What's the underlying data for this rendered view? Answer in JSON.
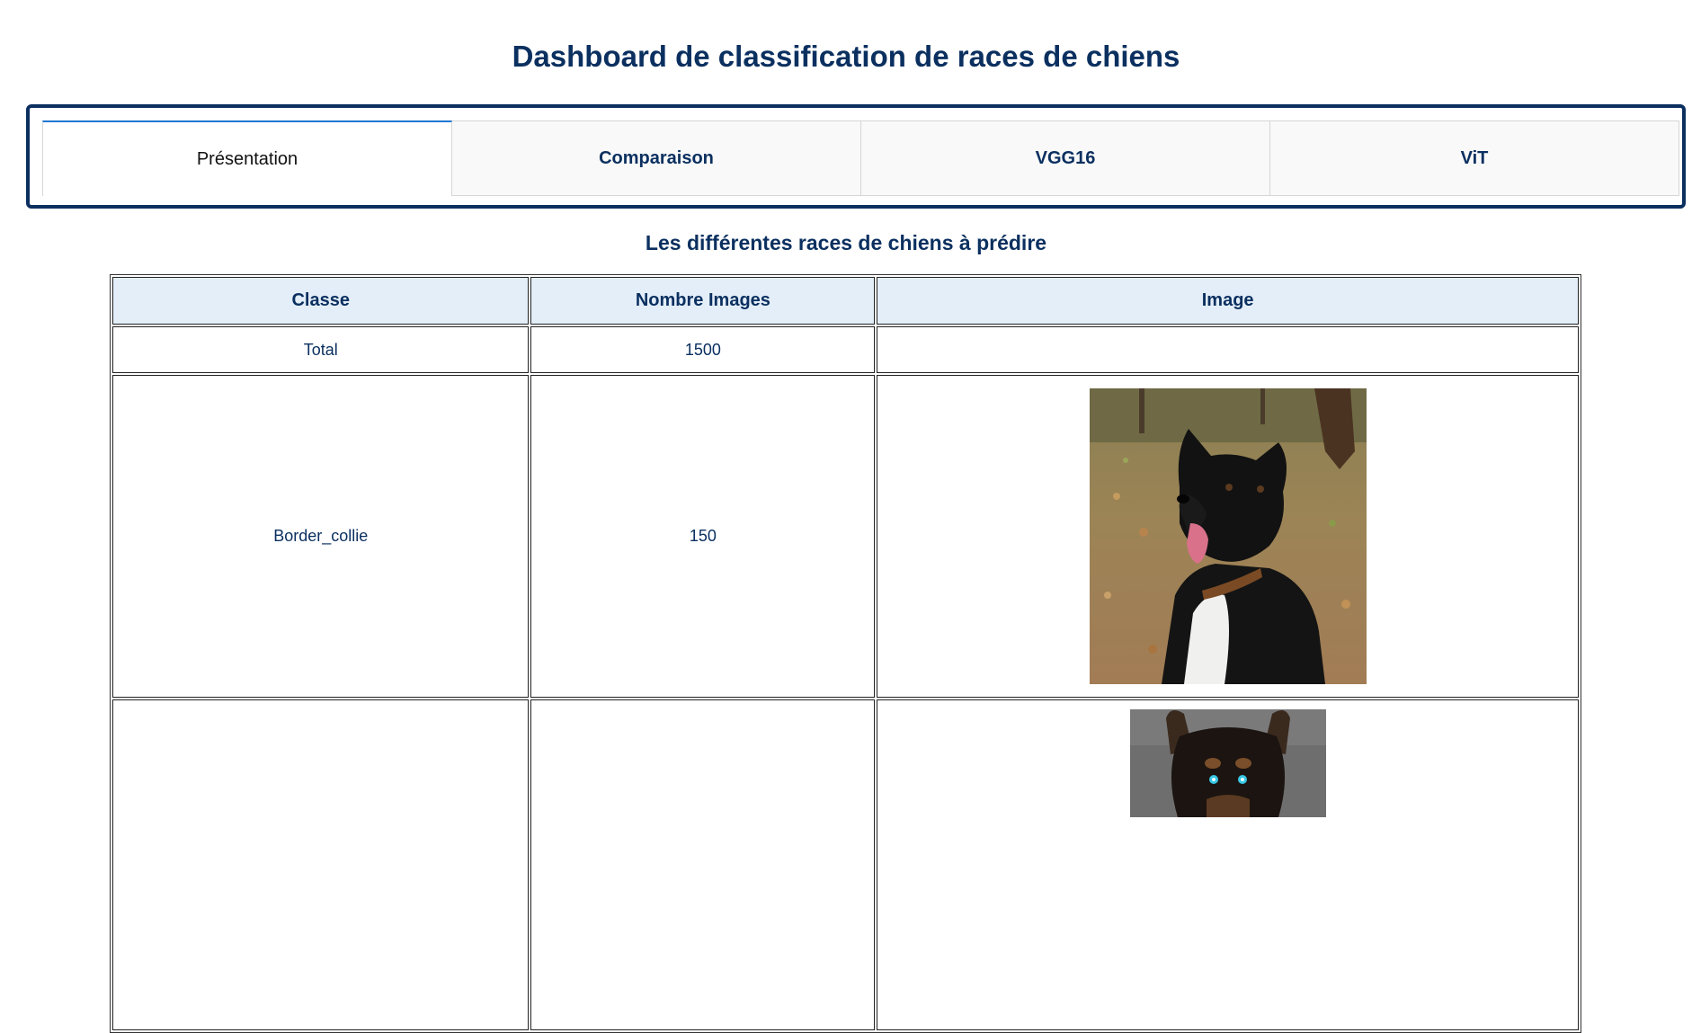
{
  "header": {
    "title": "Dashboard de classification de races de chiens"
  },
  "tabs": [
    {
      "label": "Présentation",
      "active": true
    },
    {
      "label": "Comparaison",
      "active": false
    },
    {
      "label": "VGG16",
      "active": false
    },
    {
      "label": "ViT",
      "active": false
    }
  ],
  "main": {
    "section_title": "Les différentes races de chiens à prédire",
    "table": {
      "columns": [
        "Classe",
        "Nombre Images",
        "Image"
      ],
      "rows": [
        {
          "classe": "Total",
          "nombre": "1500",
          "image": ""
        },
        {
          "classe": "Border_collie",
          "nombre": "150",
          "image": "border-collie-photo"
        },
        {
          "classe": "",
          "nombre": "",
          "image": "dobermann-photo"
        }
      ]
    }
  },
  "colors": {
    "primary": "#0b3060",
    "header_bg": "#e3eef9",
    "active_tab_accent": "#1f77d0",
    "tab_bg": "#f9f9f9"
  }
}
